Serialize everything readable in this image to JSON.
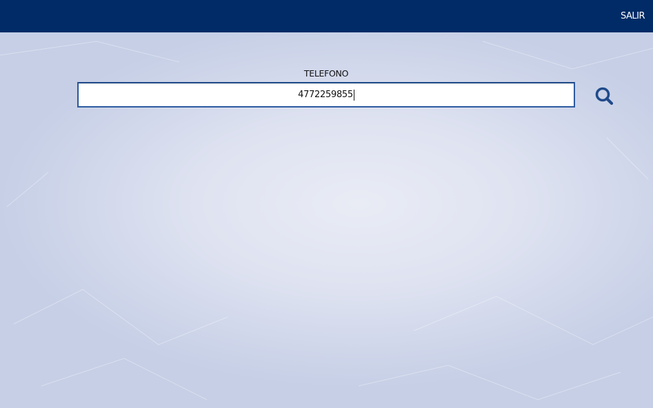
{
  "header": {
    "exit_label": "SALIR"
  },
  "form": {
    "phone_label": "TELEFONO",
    "phone_value": "4772259855"
  },
  "icons": {
    "search": "search-icon"
  },
  "colors": {
    "topbar": "#002b66",
    "accent": "#1f4a8a"
  }
}
